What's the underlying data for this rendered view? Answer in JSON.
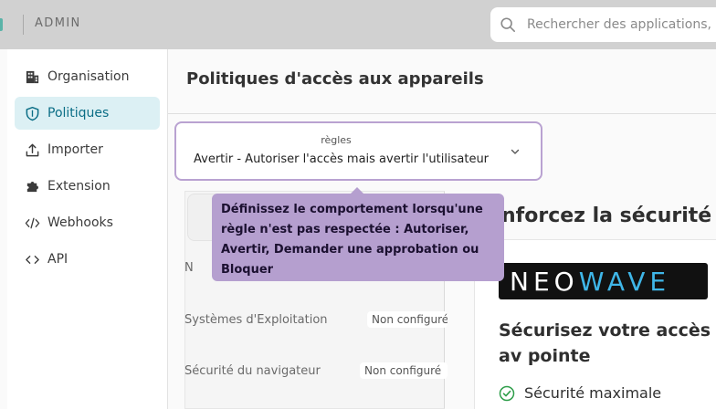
{
  "header": {
    "admin_label": "ADMIN",
    "search_placeholder": "Rechercher des applications,"
  },
  "sidebar": {
    "items": [
      {
        "label": "Organisation",
        "icon": "building-icon",
        "active": false
      },
      {
        "label": "Politiques",
        "icon": "shield-icon",
        "active": true
      },
      {
        "label": "Importer",
        "icon": "upload-icon",
        "active": false
      },
      {
        "label": "Extension",
        "icon": "puzzle-icon",
        "active": false
      },
      {
        "label": "Webhooks",
        "icon": "code-slash-icon",
        "active": false
      },
      {
        "label": "API",
        "icon": "code-icon",
        "active": false
      }
    ]
  },
  "main": {
    "page_title": "Politiques d'accès aux appareils",
    "rule_select": {
      "label": "règles",
      "value": "Avertir - Autoriser l'accès mais avertir l'utilisateur"
    },
    "rows": [
      {
        "label": "N",
        "value": ""
      },
      {
        "label": "Systèmes d'Exploitation",
        "value": "Non configuré"
      },
      {
        "label": "Sécurité du navigateur",
        "value": "Non configuré"
      }
    ],
    "promo": {
      "title": "nforcez la sécurité",
      "logo_text": "NEOWAVE",
      "heading": "Sécurisez votre accès av pointe",
      "feature": "Sécurité maximale"
    },
    "tooltip": "Définissez le comportement lorsqu'une règle n'est pas respectée : Autoriser, Avertir, Demander une approbation ou Bloquer"
  },
  "colors": {
    "accent": "#0b6e86",
    "active_bg": "#dcf0f4",
    "tooltip_bg": "#b59fcf",
    "select_border": "#b9a2d1",
    "success": "#2e9e4a"
  }
}
